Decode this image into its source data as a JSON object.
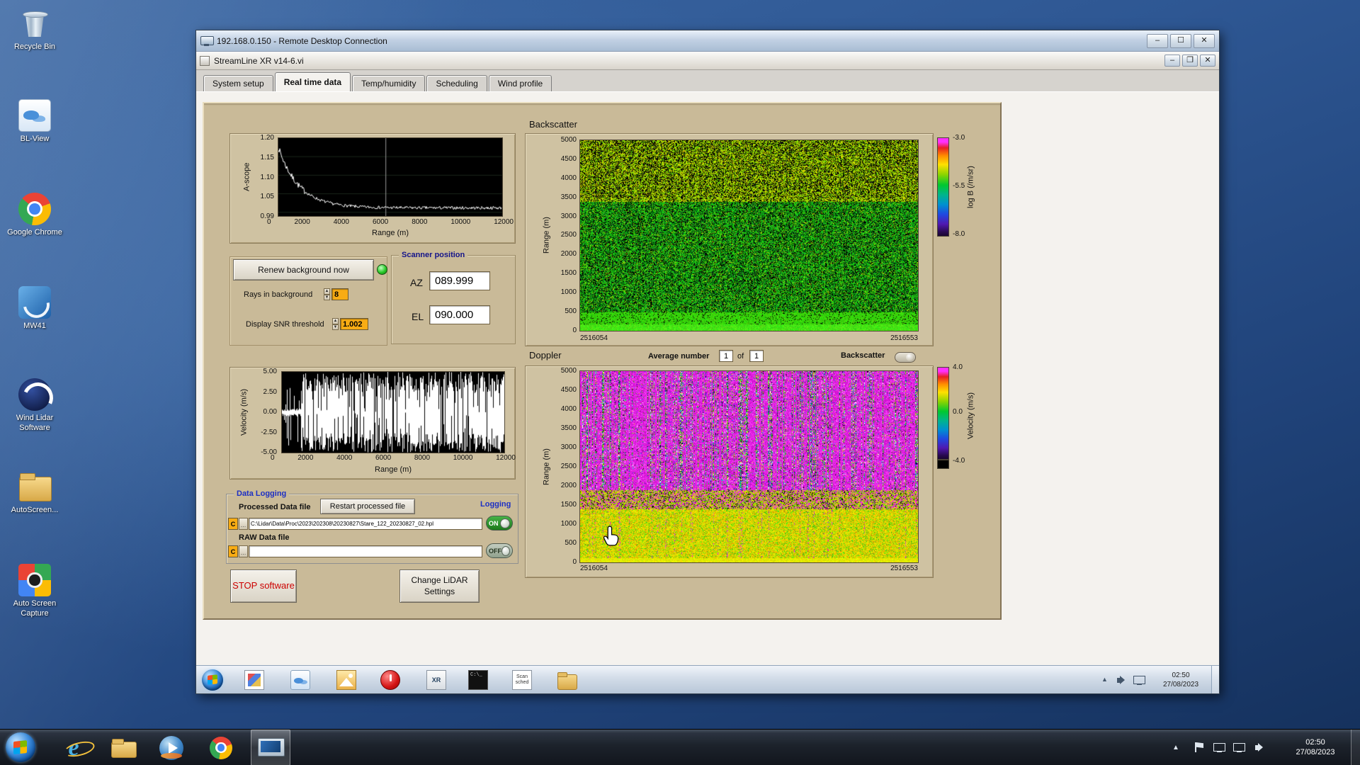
{
  "desktop": {
    "icons": [
      {
        "label": "Recycle Bin"
      },
      {
        "label": "BL-View"
      },
      {
        "label": "Google Chrome"
      },
      {
        "label": "MW41"
      },
      {
        "label": "Wind Lidar Software"
      },
      {
        "label": "AutoScreen..."
      },
      {
        "label": "Auto Screen Capture"
      }
    ]
  },
  "rdp": {
    "title": "192.168.0.150 - Remote Desktop Connection"
  },
  "app": {
    "title": "StreamLine XR v14-6.vi",
    "tabs": [
      "System setup",
      "Real time data",
      "Temp/humidity",
      "Scheduling",
      "Wind profile"
    ]
  },
  "ascope": {
    "axis_label": "A-scope",
    "x_label": "Range (m)",
    "y_ticks": [
      "1.20",
      "1.15",
      "1.10",
      "1.05",
      "0.99"
    ],
    "x_ticks": [
      "0",
      "2000",
      "4000",
      "6000",
      "8000",
      "10000",
      "12000"
    ]
  },
  "background_controls": {
    "renew_button": "Renew background now",
    "rays_label": "Rays in background",
    "rays_value": "8",
    "snr_label": "Display SNR threshold",
    "snr_value": "1.002"
  },
  "scanner": {
    "title": "Scanner position",
    "az_label": "AZ",
    "az_value": "089.999",
    "el_label": "EL",
    "el_value": "090.000"
  },
  "backscatter": {
    "title": "Backscatter",
    "y_label": "Range (m)",
    "y_ticks": [
      "5000",
      "4500",
      "4000",
      "3500",
      "3000",
      "2500",
      "2000",
      "1500",
      "1000",
      "500",
      "0"
    ],
    "x_start": "2516054",
    "x_end": "2516553",
    "colorbar_label": "log B (/m/sr)",
    "colorbar_ticks": [
      "-3.0",
      "-5.5",
      "-8.0"
    ]
  },
  "doppler": {
    "title": "Doppler",
    "average_label": "Average number",
    "average_value": "1",
    "of_label": "of",
    "count_value": "1",
    "toggle_label": "Backscatter",
    "y_label": "Range (m)",
    "y_ticks": [
      "5000",
      "4500",
      "4000",
      "3500",
      "3000",
      "2500",
      "2000",
      "1500",
      "1000",
      "500",
      "0"
    ],
    "x_start": "2516054",
    "x_end": "2516553",
    "colorbar_label": "Velocity (m/s)",
    "colorbar_ticks": [
      "4.0",
      "0.0",
      "-4.0"
    ]
  },
  "velocity": {
    "axis_label": "Velocity (m/s)",
    "x_label": "Range (m)",
    "y_ticks": [
      "5.00",
      "2.50",
      "0.00",
      "-2.50",
      "-5.00"
    ],
    "x_ticks": [
      "0",
      "2000",
      "4000",
      "6000",
      "8000",
      "10000",
      "12000"
    ]
  },
  "logging": {
    "section_title": "Data Logging",
    "processed_label": "Processed Data file",
    "restart_button": "Restart processed file",
    "logging_label": "Logging",
    "drive_label": "C",
    "processed_path": "C:\\Lidar\\Data\\Proc\\2023\\202308\\20230827\\Stare_122_20230827_02.hpl",
    "on_label": "ON",
    "raw_label": "RAW Data file",
    "raw_path": "",
    "off_label": "OFF"
  },
  "actions": {
    "stop_button": "STOP software",
    "settings_button": "Change LiDAR Settings"
  },
  "session_taskbar": {
    "xr_label": "XR",
    "cmd_label": "C:\\_",
    "scan_sched_label": "Scan sched",
    "time": "02:50",
    "date": "27/08/2023"
  },
  "host_taskbar": {
    "time": "02:50",
    "date": "27/08/2023"
  }
}
